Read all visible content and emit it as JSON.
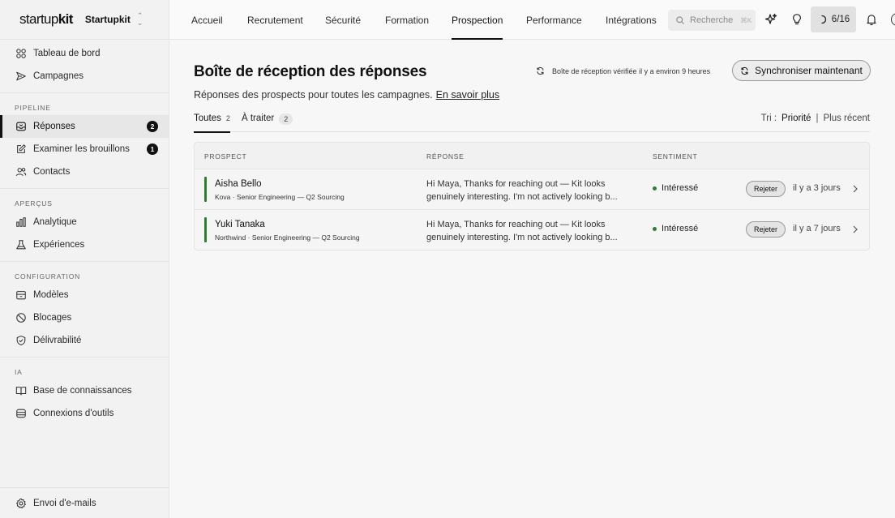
{
  "sidebar": {
    "logo_light": "startup",
    "logo_bold": "kit",
    "workspace": "Startupkit",
    "top_items": [
      {
        "label": "Tableau de bord"
      },
      {
        "label": "Campagnes"
      }
    ],
    "groups": [
      {
        "label": "PIPELINE",
        "items": [
          {
            "label": "Réponses",
            "badge": "2"
          },
          {
            "label": "Examiner les brouillons",
            "badge": "1"
          },
          {
            "label": "Contacts"
          }
        ]
      },
      {
        "label": "APERÇUS",
        "items": [
          {
            "label": "Analytique"
          },
          {
            "label": "Expériences"
          }
        ]
      },
      {
        "label": "CONFIGURATION",
        "items": [
          {
            "label": "Modèles"
          },
          {
            "label": "Blocages"
          },
          {
            "label": "Délivrabilité"
          }
        ]
      },
      {
        "label": "IA",
        "items": [
          {
            "label": "Base de connaissances"
          },
          {
            "label": "Connexions d'outils"
          }
        ]
      }
    ],
    "bottom_item": "Envoi d'e-mails"
  },
  "topnav": {
    "tabs": [
      "Accueil",
      "Recrutement",
      "Sécurité",
      "Formation",
      "Prospection",
      "Performance",
      "Intégrations"
    ],
    "active_tab": "Prospection",
    "search_placeholder": "Recherche",
    "search_shortcut": "⌘K",
    "progress": "6/16"
  },
  "main": {
    "title": "Boîte de réception des réponses",
    "sync_status": "Boîte de réception vérifiée il y a environ 9 heures",
    "sync_button": "Synchroniser maintenant",
    "subtitle": "Réponses des prospects pour toutes les campagnes.",
    "learn_more": "En savoir plus",
    "filters": [
      {
        "label": "Toutes",
        "count": "2"
      },
      {
        "label": "À traiter",
        "count": "2"
      }
    ],
    "sort_label": "Tri :",
    "sort_options": [
      "Priorité",
      "Plus récent"
    ],
    "columns": [
      "PROSPECT",
      "RÉPONSE",
      "SENTIMENT"
    ],
    "rows": [
      {
        "name": "Aisha Bello",
        "sub": "Kova · Senior Engineering — Q2 Sourcing",
        "reply_line1": "Hi Maya, Thanks for reaching out — Kit looks",
        "reply_line2": "genuinely interesting. I'm not actively looking b...",
        "sentiment": "Intéressé",
        "action": "Rejeter",
        "time": "il y a 3 jours"
      },
      {
        "name": "Yuki Tanaka",
        "sub": "Northwind · Senior Engineering — Q2 Sourcing",
        "reply_line1": "Hi Maya, Thanks for reaching out — Kit looks",
        "reply_line2": "genuinely interesting. I'm not actively looking b...",
        "sentiment": "Intéressé",
        "action": "Rejeter",
        "time": "il y a 7 jours"
      }
    ]
  },
  "colors": {
    "accent": "#111111",
    "positive": "#2e7d32",
    "sidebar_bg": "#f2f2f2"
  }
}
